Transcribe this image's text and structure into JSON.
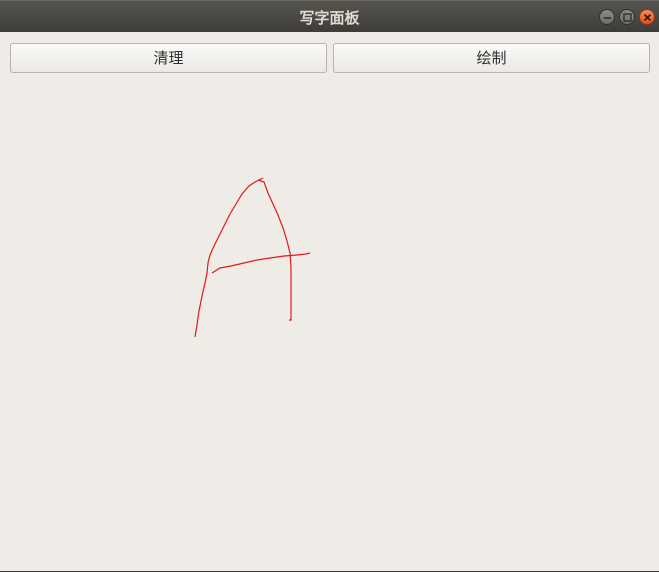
{
  "window": {
    "title": "写字面板",
    "controls": [
      "minimize-icon",
      "maximize-icon",
      "close-icon"
    ]
  },
  "toolbar": {
    "clear_label": "清理",
    "draw_label": "绘制"
  },
  "canvas": {
    "stroke_color": "#e11a1a"
  }
}
